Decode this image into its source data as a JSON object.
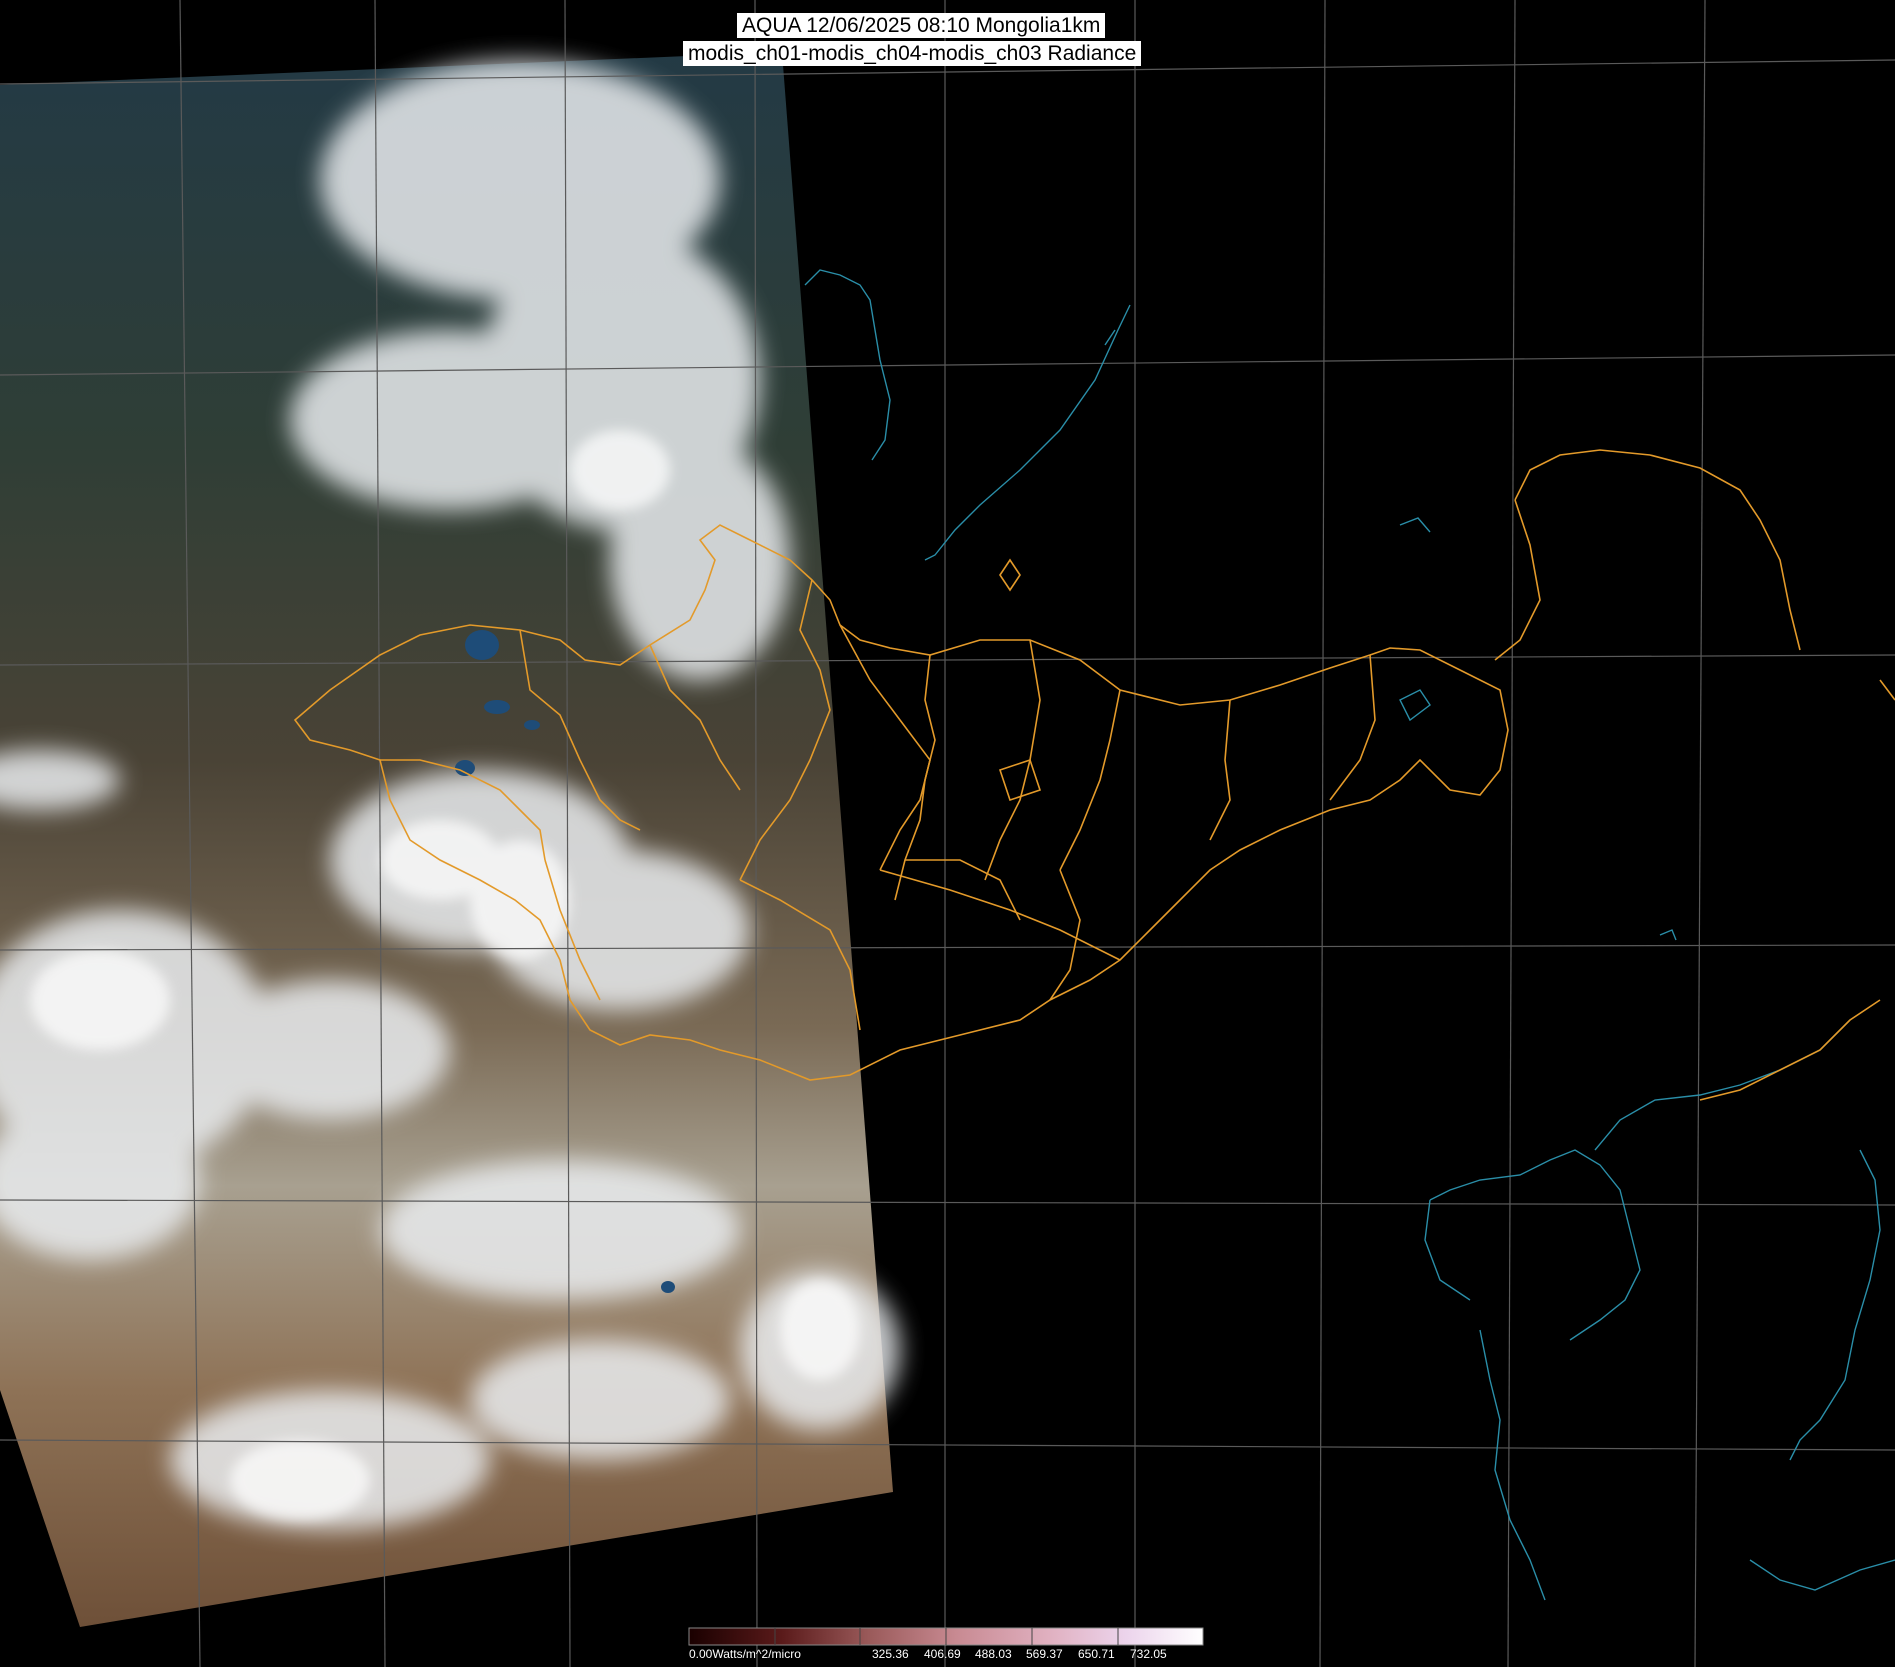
{
  "header": {
    "line1": "AQUA 12/06/2025 08:10 Mongolia1km",
    "line2": "modis_ch01-modis_ch04-modis_ch03 Radiance"
  },
  "colorbar": {
    "unit_label": "0.00Watts/m^2/micro",
    "ticks": [
      "325.36",
      "406.69",
      "488.03",
      "569.37",
      "650.71",
      "732.05"
    ],
    "gradient": [
      "#1a0000",
      "#5a1a1a",
      "#9a5a5a",
      "#c88a92",
      "#e0b0c0",
      "#ecd4ec",
      "#ffffff"
    ]
  },
  "colors": {
    "background": "#000000",
    "grid": "#5a5a5a",
    "borders": "#e39a2a",
    "coastline": "#2a8ea8"
  }
}
